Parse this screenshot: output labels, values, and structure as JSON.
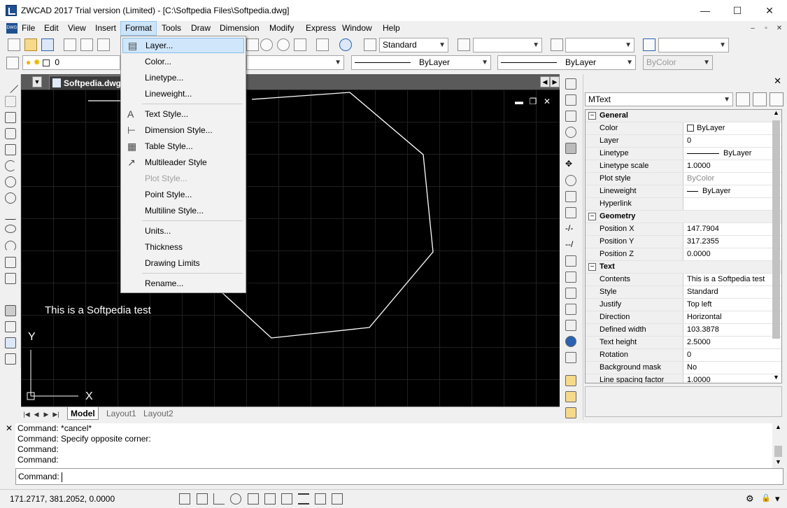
{
  "window": {
    "title": "ZWCAD 2017 Trial version (Limited) - [C:\\Softpedia Files\\Softpedia.dwg]",
    "minimize_glyph": "—",
    "maximize_glyph": "☐",
    "close_glyph": "✕"
  },
  "menu": {
    "logo_label": "DWG",
    "items": [
      "File",
      "Edit",
      "View",
      "Insert",
      "Format",
      "Tools",
      "Draw",
      "Dimension",
      "Modify",
      "Express",
      "Window",
      "Help"
    ],
    "active": "Format",
    "mdi_minimize": "–",
    "mdi_restore": "▫",
    "mdi_close": "✕"
  },
  "toolbar": {
    "text_style": "Standard",
    "dim_style": "",
    "table_style": "",
    "mleader_style": "",
    "layer_value": "0",
    "linetype": "ByLayer",
    "lineweight": "ByLayer",
    "plot_style": "ByColor"
  },
  "document": {
    "tab_label": "Softpedia.dwg",
    "canvas_text": "This is a Softpedia test",
    "axis_x": "X",
    "axis_y": "Y"
  },
  "layout_tabs": [
    "Model",
    "Layout1",
    "Layout2"
  ],
  "format_menu": {
    "items": [
      {
        "label": "Layer...",
        "icon": "layer-icon",
        "state": "hover"
      },
      {
        "label": "Color...",
        "icon": "",
        "state": "normal"
      },
      {
        "label": "Linetype...",
        "icon": "",
        "state": "normal"
      },
      {
        "label": "Lineweight...",
        "icon": "",
        "state": "normal"
      },
      {
        "label": "Text Style...",
        "icon": "text-style-icon",
        "state": "normal"
      },
      {
        "label": "Dimension Style...",
        "icon": "dimension-style-icon",
        "state": "normal"
      },
      {
        "label": "Table Style...",
        "icon": "table-style-icon",
        "state": "normal"
      },
      {
        "label": "Multileader Style",
        "icon": "multileader-style-icon",
        "state": "normal"
      },
      {
        "label": "Plot Style...",
        "icon": "",
        "state": "disabled"
      },
      {
        "label": "Point Style...",
        "icon": "",
        "state": "normal"
      },
      {
        "label": "Multiline Style...",
        "icon": "",
        "state": "normal"
      },
      {
        "label": "Units...",
        "icon": "",
        "state": "normal"
      },
      {
        "label": "Thickness",
        "icon": "",
        "state": "normal"
      },
      {
        "label": "Drawing Limits",
        "icon": "",
        "state": "normal"
      },
      {
        "label": "Rename...",
        "icon": "",
        "state": "normal"
      }
    ]
  },
  "properties": {
    "object_type": "MText",
    "close_glyph": "✕",
    "categories": [
      {
        "name": "General",
        "rows": [
          {
            "name": "Color",
            "value": "ByLayer",
            "kind": "color"
          },
          {
            "name": "Layer",
            "value": "0",
            "kind": "text"
          },
          {
            "name": "Linetype",
            "value": "ByLayer",
            "kind": "line"
          },
          {
            "name": "Linetype scale",
            "value": "1.0000",
            "kind": "text"
          },
          {
            "name": "Plot style",
            "value": "ByColor",
            "kind": "grey"
          },
          {
            "name": "Lineweight",
            "value": "ByLayer",
            "kind": "shortline"
          },
          {
            "name": "Hyperlink",
            "value": "",
            "kind": "text"
          }
        ]
      },
      {
        "name": "Geometry",
        "rows": [
          {
            "name": "Position X",
            "value": "147.7904",
            "kind": "text"
          },
          {
            "name": "Position Y",
            "value": "317.2355",
            "kind": "text"
          },
          {
            "name": "Position Z",
            "value": "0.0000",
            "kind": "text"
          }
        ]
      },
      {
        "name": "Text",
        "rows": [
          {
            "name": "Contents",
            "value": "This is a Softpedia test",
            "kind": "text"
          },
          {
            "name": "Style",
            "value": "Standard",
            "kind": "text"
          },
          {
            "name": "Justify",
            "value": "Top left",
            "kind": "text"
          },
          {
            "name": "Direction",
            "value": "Horizontal",
            "kind": "text"
          },
          {
            "name": "Defined width",
            "value": "103.3878",
            "kind": "text"
          },
          {
            "name": "Text height",
            "value": "2.5000",
            "kind": "text"
          },
          {
            "name": "Rotation",
            "value": "0",
            "kind": "text"
          },
          {
            "name": "Background mask",
            "value": "No",
            "kind": "text"
          },
          {
            "name": "Line spacing factor",
            "value": "1.0000",
            "kind": "text"
          }
        ]
      }
    ]
  },
  "command": {
    "close_glyph": "✕",
    "history": [
      "Command: *cancel*",
      "Command: Specify opposite corner:",
      "Command:",
      "Command:"
    ],
    "prompt": "Command:"
  },
  "status": {
    "coords": "171.2717, 381.2052, 0.0000",
    "settings_glyph": "⚙",
    "lock_glyph": "🔒",
    "customize_glyph": "▾"
  }
}
